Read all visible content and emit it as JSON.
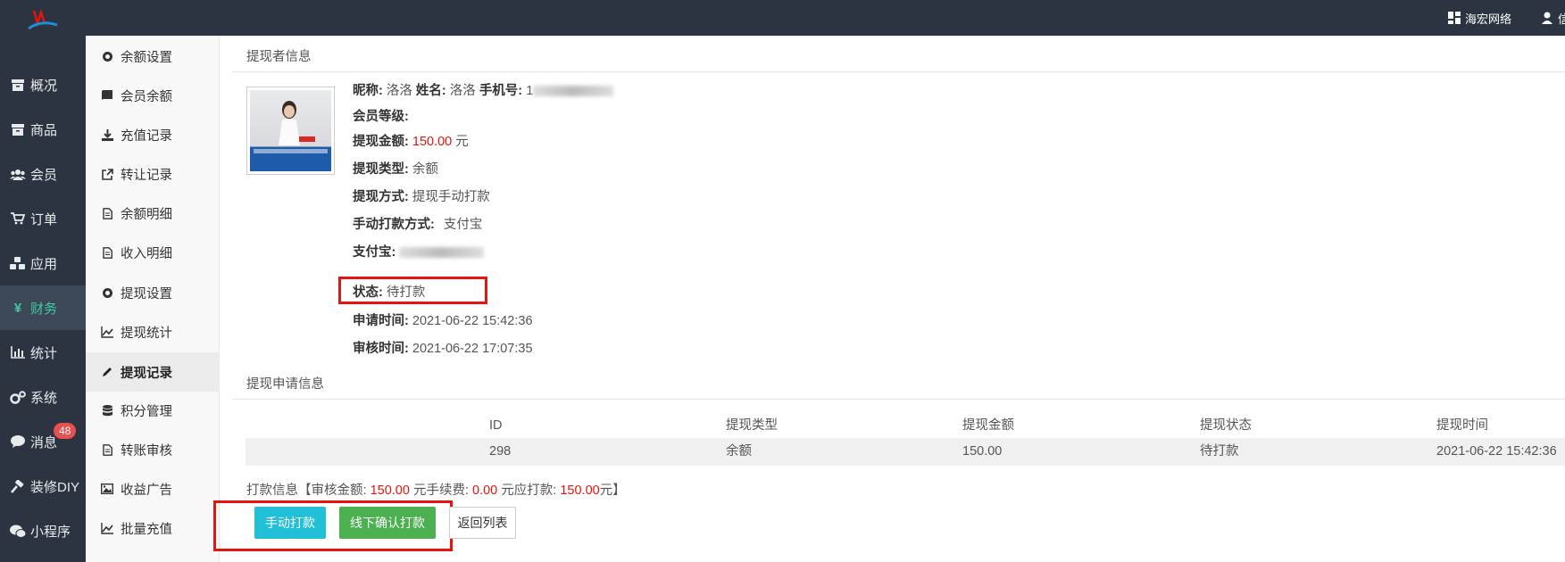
{
  "topbar": {
    "network_label": "海宏网络",
    "user_label": "信"
  },
  "nav": {
    "items": [
      {
        "label": "概况",
        "icon": "box-icon"
      },
      {
        "label": "商品",
        "icon": "box-icon"
      },
      {
        "label": "会员",
        "icon": "users-icon"
      },
      {
        "label": "订单",
        "icon": "cart-icon"
      },
      {
        "label": "应用",
        "icon": "cubes-icon"
      },
      {
        "label": "财务",
        "icon": "yen-icon"
      },
      {
        "label": "统计",
        "icon": "bar-chart-icon"
      },
      {
        "label": "系统",
        "icon": "gears-icon"
      },
      {
        "label": "消息",
        "icon": "comment-icon"
      },
      {
        "label": "装修DIY",
        "icon": "gavel-icon"
      },
      {
        "label": "小程序",
        "icon": "wechat-icon"
      }
    ],
    "active": "财务",
    "message_badge": "48"
  },
  "subnav": {
    "items": [
      {
        "label": "余额设置",
        "icon": "gear-icon"
      },
      {
        "label": "会员余额",
        "icon": "book-icon"
      },
      {
        "label": "充值记录",
        "icon": "download-icon"
      },
      {
        "label": "转让记录",
        "icon": "external-link-icon"
      },
      {
        "label": "余额明细",
        "icon": "file-icon"
      },
      {
        "label": "收入明细",
        "icon": "file-icon"
      },
      {
        "label": "提现设置",
        "icon": "gear-icon"
      },
      {
        "label": "提现统计",
        "icon": "line-chart-icon"
      },
      {
        "label": "提现记录",
        "icon": "pencil-icon"
      },
      {
        "label": "积分管理",
        "icon": "database-icon"
      },
      {
        "label": "转账审核",
        "icon": "file-icon"
      },
      {
        "label": "收益广告",
        "icon": "image-icon"
      },
      {
        "label": "批量充值",
        "icon": "line-chart-icon"
      }
    ],
    "active": "提现记录"
  },
  "withdrawer": {
    "section_title": "提现者信息",
    "nickname_label": "昵称:",
    "nickname": "洛洛",
    "name_label": "姓名:",
    "name": "洛洛",
    "phone_label": "手机号:",
    "phone_visible": "1",
    "level_label": "会员等级:",
    "amount_label": "提现金额:",
    "amount": "150.00",
    "amount_unit": "元",
    "type_label": "提现类型:",
    "type": "余额",
    "method_label": "提现方式:",
    "method": "提现手动打款",
    "manual_method_label": "手动打款方式:",
    "manual_method": "支付宝",
    "alipay_label": "支付宝:",
    "status_label": "状态:",
    "status": "待打款",
    "apply_time_label": "申请时间:",
    "apply_time": "2021-06-22 15:42:36",
    "review_time_label": "审核时间:",
    "review_time": "2021-06-22 17:07:35"
  },
  "application": {
    "section_title": "提现申请信息",
    "columns": [
      "ID",
      "提现类型",
      "提现金额",
      "提现状态",
      "提现时间"
    ],
    "rows": [
      [
        "298",
        "余额",
        "150.00",
        "待打款",
        "2021-06-22 15:42:36"
      ]
    ]
  },
  "payment": {
    "prefix": "打款信息【审核金额:",
    "review_amount": "150.00",
    "fee_label": "元手续费:",
    "fee": "0.00",
    "should_pay_label": "元应打款:",
    "should_pay": "150.00",
    "suffix": "元】"
  },
  "actions": {
    "manual_pay": "手动打款",
    "offline_confirm": "线下确认打款",
    "back": "返回列表"
  },
  "colors": {
    "topbar": "#2b3440",
    "active_nav_text": "#3fc9a8",
    "highlight": "#e5140f",
    "cyan_button": "#21c0d6",
    "green_button": "#4caf50"
  }
}
